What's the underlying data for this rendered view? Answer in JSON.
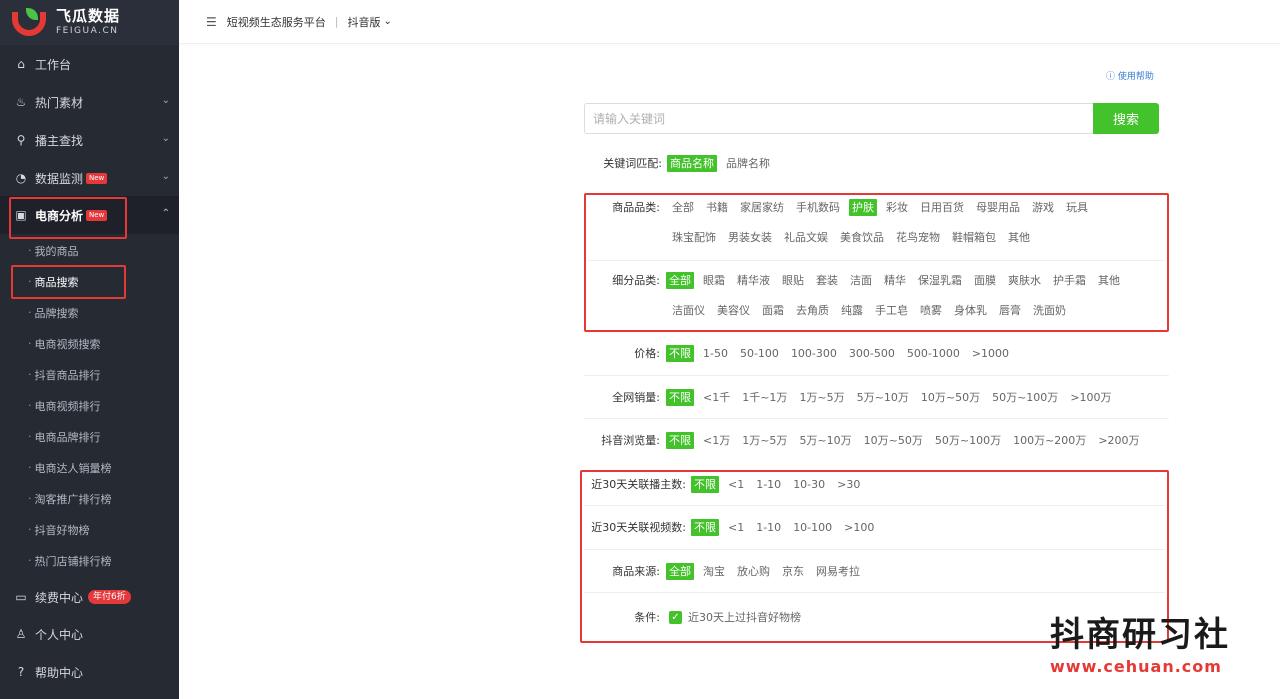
{
  "brand": {
    "name_cn": "飞瓜数据",
    "name_en": "FEIGUA.CN"
  },
  "header": {
    "platform": "短视频生态服务平台",
    "version": "抖音版"
  },
  "sidebar": {
    "items": [
      {
        "label": "工作台"
      },
      {
        "label": "热门素材"
      },
      {
        "label": "播主查找"
      },
      {
        "label": "数据监测",
        "badge": "New"
      },
      {
        "label": "电商分析",
        "badge": "New"
      }
    ],
    "sub_items": [
      "我的商品",
      "商品搜索",
      "品牌搜索",
      "电商视频搜索",
      "抖音商品排行",
      "电商视频排行",
      "电商品牌排行",
      "电商达人销量榜",
      "淘客推广排行榜",
      "抖音好物榜",
      "热门店铺排行榜"
    ],
    "bottom_items": [
      {
        "label": "续费中心",
        "badge": "年付6折"
      },
      {
        "label": "个人中心"
      },
      {
        "label": "帮助中心"
      }
    ]
  },
  "main": {
    "help": "使用帮助",
    "search": {
      "placeholder": "请输入关键词",
      "button": "搜索"
    },
    "keyword_match": {
      "label": "关键词匹配:",
      "options": [
        "商品名称",
        "品牌名称"
      ]
    },
    "category": {
      "label": "商品品类:",
      "options_line1": [
        "全部",
        "书籍",
        "家居家纺",
        "手机数码",
        "护肤",
        "彩妆",
        "日用百货",
        "母婴用品",
        "游戏",
        "玩具"
      ],
      "options_line2": [
        "珠宝配饰",
        "男装女装",
        "礼品文娱",
        "美食饮品",
        "花鸟宠物",
        "鞋帽箱包",
        "其他"
      ]
    },
    "subcategory": {
      "label": "细分品类:",
      "options_line1": [
        "全部",
        "眼霜",
        "精华液",
        "眼贴",
        "套装",
        "洁面",
        "精华",
        "保湿乳霜",
        "面膜",
        "爽肤水",
        "护手霜",
        "其他"
      ],
      "options_line2": [
        "洁面仪",
        "美容仪",
        "面霜",
        "去角质",
        "纯露",
        "手工皂",
        "喷雾",
        "身体乳",
        "唇膏",
        "洗面奶"
      ]
    },
    "price": {
      "label": "价格:",
      "options": [
        "不限",
        "1-50",
        "50-100",
        "100-300",
        "300-500",
        "500-1000",
        ">1000"
      ]
    },
    "sales": {
      "label": "全网销量:",
      "options": [
        "不限",
        "<1千",
        "1千~1万",
        "1万~5万",
        "5万~10万",
        "10万~50万",
        "50万~100万",
        ">100万"
      ]
    },
    "views": {
      "label": "抖音浏览量:",
      "options": [
        "不限",
        "<1万",
        "1万~5万",
        "5万~10万",
        "10万~50万",
        "50万~100万",
        "100万~200万",
        ">200万"
      ]
    },
    "streamers": {
      "label": "近30天关联播主数:",
      "options": [
        "不限",
        "<1",
        "1-10",
        "10-30",
        ">30"
      ]
    },
    "videos": {
      "label": "近30天关联视频数:",
      "options": [
        "不限",
        "<1",
        "1-10",
        "10-100",
        ">100"
      ]
    },
    "source": {
      "label": "商品来源:",
      "options": [
        "全部",
        "淘宝",
        "放心购",
        "京东",
        "网易考拉"
      ]
    },
    "condition": {
      "label": "条件:",
      "text": "近30天上过抖音好物榜"
    }
  },
  "watermark": {
    "line1": "抖商研习社",
    "line2": "www.cehuan.com"
  },
  "colors": {
    "accent": "#43c22b",
    "sidebar": "#262a33",
    "highlight": "#e53935"
  }
}
